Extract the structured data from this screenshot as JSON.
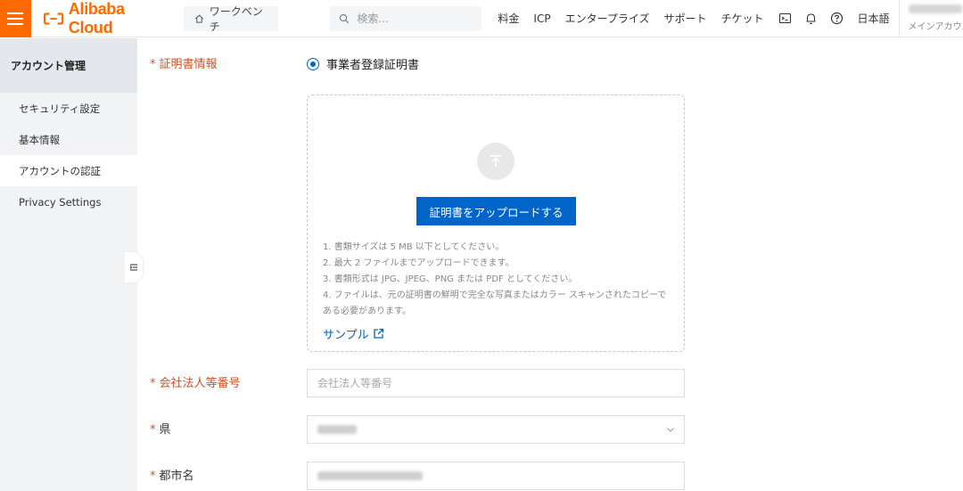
{
  "header": {
    "brand": "Alibaba Cloud",
    "workbench": "ワークベンチ",
    "search_placeholder": "検索...",
    "nav": [
      "料金",
      "ICP",
      "エンタープライズ",
      "サポート",
      "チケット"
    ],
    "language": "日本語",
    "account_type": "メインアカウ..."
  },
  "sidebar": {
    "title": "アカウント管理",
    "items": [
      {
        "label": "セキュリティ設定"
      },
      {
        "label": "基本情報"
      },
      {
        "label": "アカウントの認証"
      },
      {
        "label": "Privacy Settings"
      }
    ]
  },
  "form": {
    "cert_label": "証明書情報",
    "cert_option": "事業者登録証明書",
    "upload_button": "証明書をアップロードする",
    "notes": [
      "1. 書類サイズは 5 MB 以下としてください。",
      "2. 最大 2 ファイルまでアップロードできます。",
      "3. 書類形式は JPG、JPEG、PNG または PDF としてください。",
      "4. ファイルは、元の証明書の鮮明で完全な写真またはカラー スキャンされたコピーである必要があります。"
    ],
    "sample_link": "サンプル",
    "corp_number_label": "会社法人等番号",
    "corp_number_placeholder": "会社法人等番号",
    "prefecture_label": "県",
    "city_label": "都市名"
  },
  "colors": {
    "brand": "#ff6a00",
    "primary": "#0064c8",
    "required": "#e5492a"
  }
}
